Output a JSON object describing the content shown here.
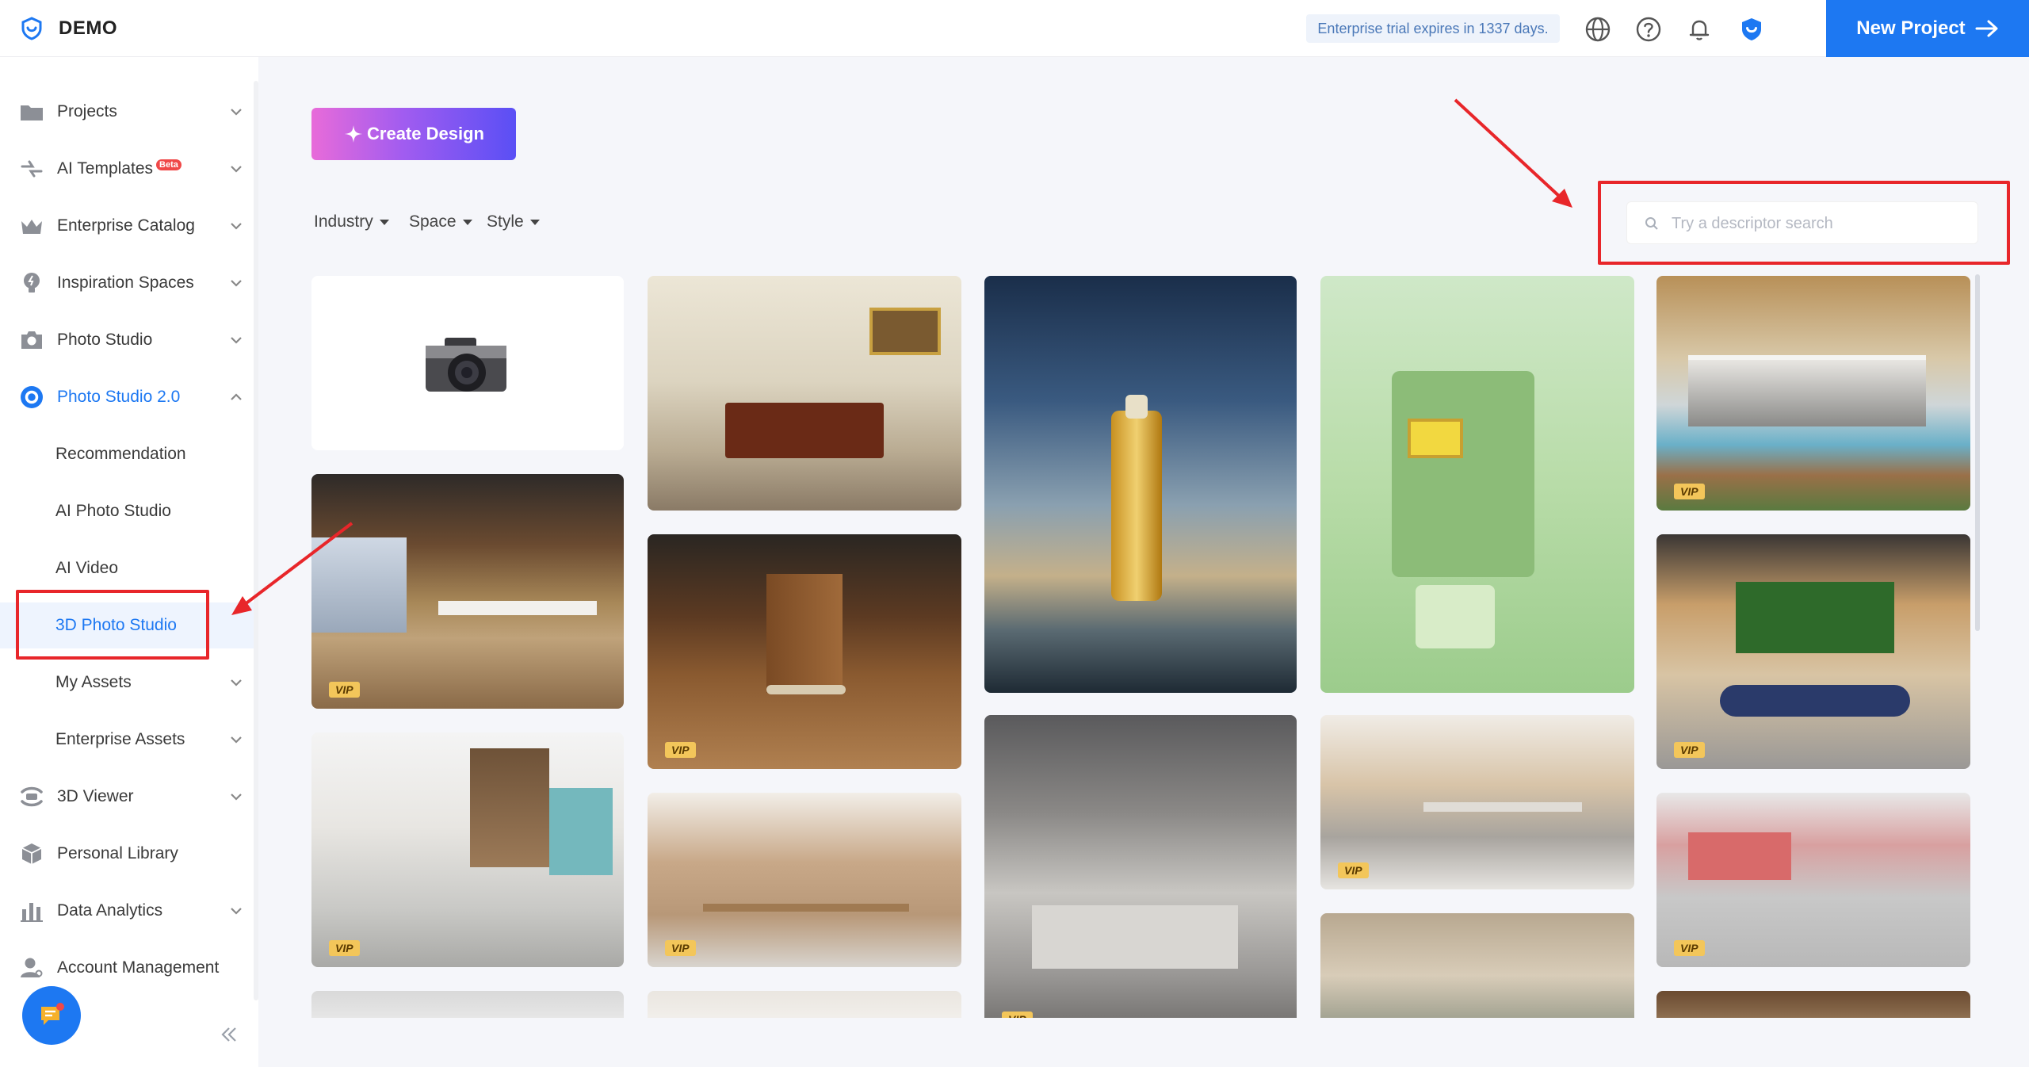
{
  "header": {
    "brand": "DEMO",
    "trial_text": "Enterprise trial expires in 1337 days.",
    "new_project_label": "New Project"
  },
  "sidebar": {
    "items": [
      {
        "label": "Projects",
        "icon": "folder-icon"
      },
      {
        "label": "AI Templates",
        "badge": "Beta",
        "icon": "ai-templates-icon"
      },
      {
        "label": "Enterprise Catalog",
        "icon": "crown-icon"
      },
      {
        "label": "Inspiration Spaces",
        "icon": "bulb-icon"
      },
      {
        "label": "Photo Studio",
        "icon": "camera-icon"
      },
      {
        "label": "Photo Studio 2.0",
        "icon": "aperture-icon",
        "expanded": true
      },
      {
        "label": "Recommendation"
      },
      {
        "label": "AI Photo Studio"
      },
      {
        "label": "AI Video"
      },
      {
        "label": "3D Photo Studio",
        "selected": true
      },
      {
        "label": "My Assets"
      },
      {
        "label": "Enterprise Assets"
      },
      {
        "label": "3D Viewer",
        "icon": "viewer-icon"
      },
      {
        "label": "Personal Library",
        "icon": "cube-icon"
      },
      {
        "label": "Data Analytics",
        "icon": "bar-chart-icon"
      },
      {
        "label": "Account Management",
        "icon": "user-icon"
      }
    ]
  },
  "main": {
    "create_design_label": "Create Design",
    "filters": [
      "Industry",
      "Space",
      "Style"
    ],
    "search_placeholder": "Try a descriptor search",
    "vip_label": "VIP"
  },
  "colors": {
    "accent": "#1d78f2",
    "annotation": "#e8262a"
  }
}
